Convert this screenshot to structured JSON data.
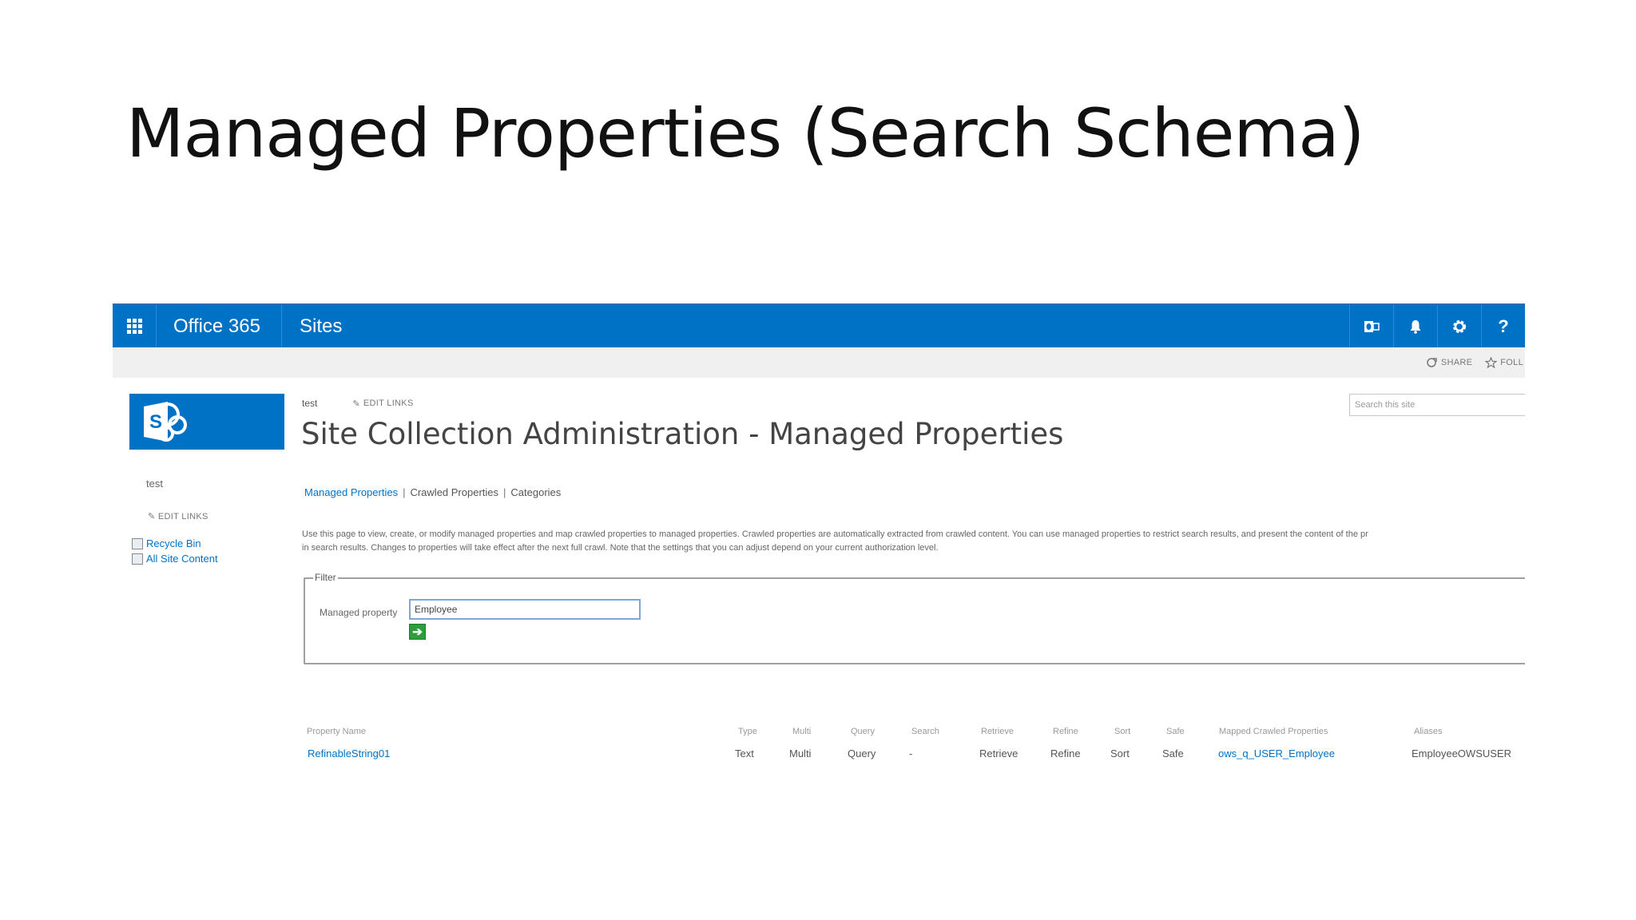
{
  "slide": {
    "title": "Managed Properties (Search Schema)"
  },
  "suite_bar": {
    "brand": "Office 365",
    "app": "Sites",
    "icons": [
      "outlook-icon",
      "bell-icon",
      "gear-icon",
      "help-icon"
    ],
    "help_glyph": "?"
  },
  "ribbon": {
    "share_label": "SHARE",
    "follow_label": "FOLL"
  },
  "site": {
    "logo_letter": "S"
  },
  "left_nav": {
    "site_name": "test",
    "edit_links": "EDIT LINKS",
    "items": [
      {
        "label": "Recycle Bin",
        "icon": "recycle-bin-icon"
      },
      {
        "label": "All Site Content",
        "icon": "site-content-icon"
      }
    ]
  },
  "breadcrumb": {
    "site": "test",
    "edit_links": "EDIT LINKS"
  },
  "page": {
    "title": "Site Collection Administration - Managed Properties"
  },
  "search": {
    "placeholder": "Search this site"
  },
  "subnav": {
    "items": [
      "Managed Properties",
      "Crawled Properties",
      "Categories"
    ],
    "separator": "|"
  },
  "description": {
    "line1": "Use this page to view, create, or modify managed properties and map crawled properties to managed properties. Crawled properties are automatically extracted from crawled content. You can use managed properties to restrict search results, and present the content of the pr",
    "line2": "in search results. Changes to properties will take effect after the next full crawl. Note that the settings that you can adjust depend on your current authorization level."
  },
  "filter": {
    "legend": "Filter",
    "label": "Managed property",
    "value": "Employee",
    "go_glyph": "➔"
  },
  "results": {
    "headers": [
      "Property Name",
      "Type",
      "Multi",
      "Query",
      "Search",
      "Retrieve",
      "Refine",
      "Sort",
      "Safe",
      "Mapped Crawled Properties",
      "Aliases"
    ],
    "rows": [
      [
        "RefinableString01",
        "Text",
        "Multi",
        "Query",
        "-",
        "Retrieve",
        "Refine",
        "Sort",
        "Safe",
        "ows_q_USER_Employee",
        "EmployeeOWSUSER"
      ]
    ]
  },
  "colors": {
    "suite_bar": "#0072c6",
    "link": "#0072c6",
    "go_button": "#2e9d3c"
  }
}
